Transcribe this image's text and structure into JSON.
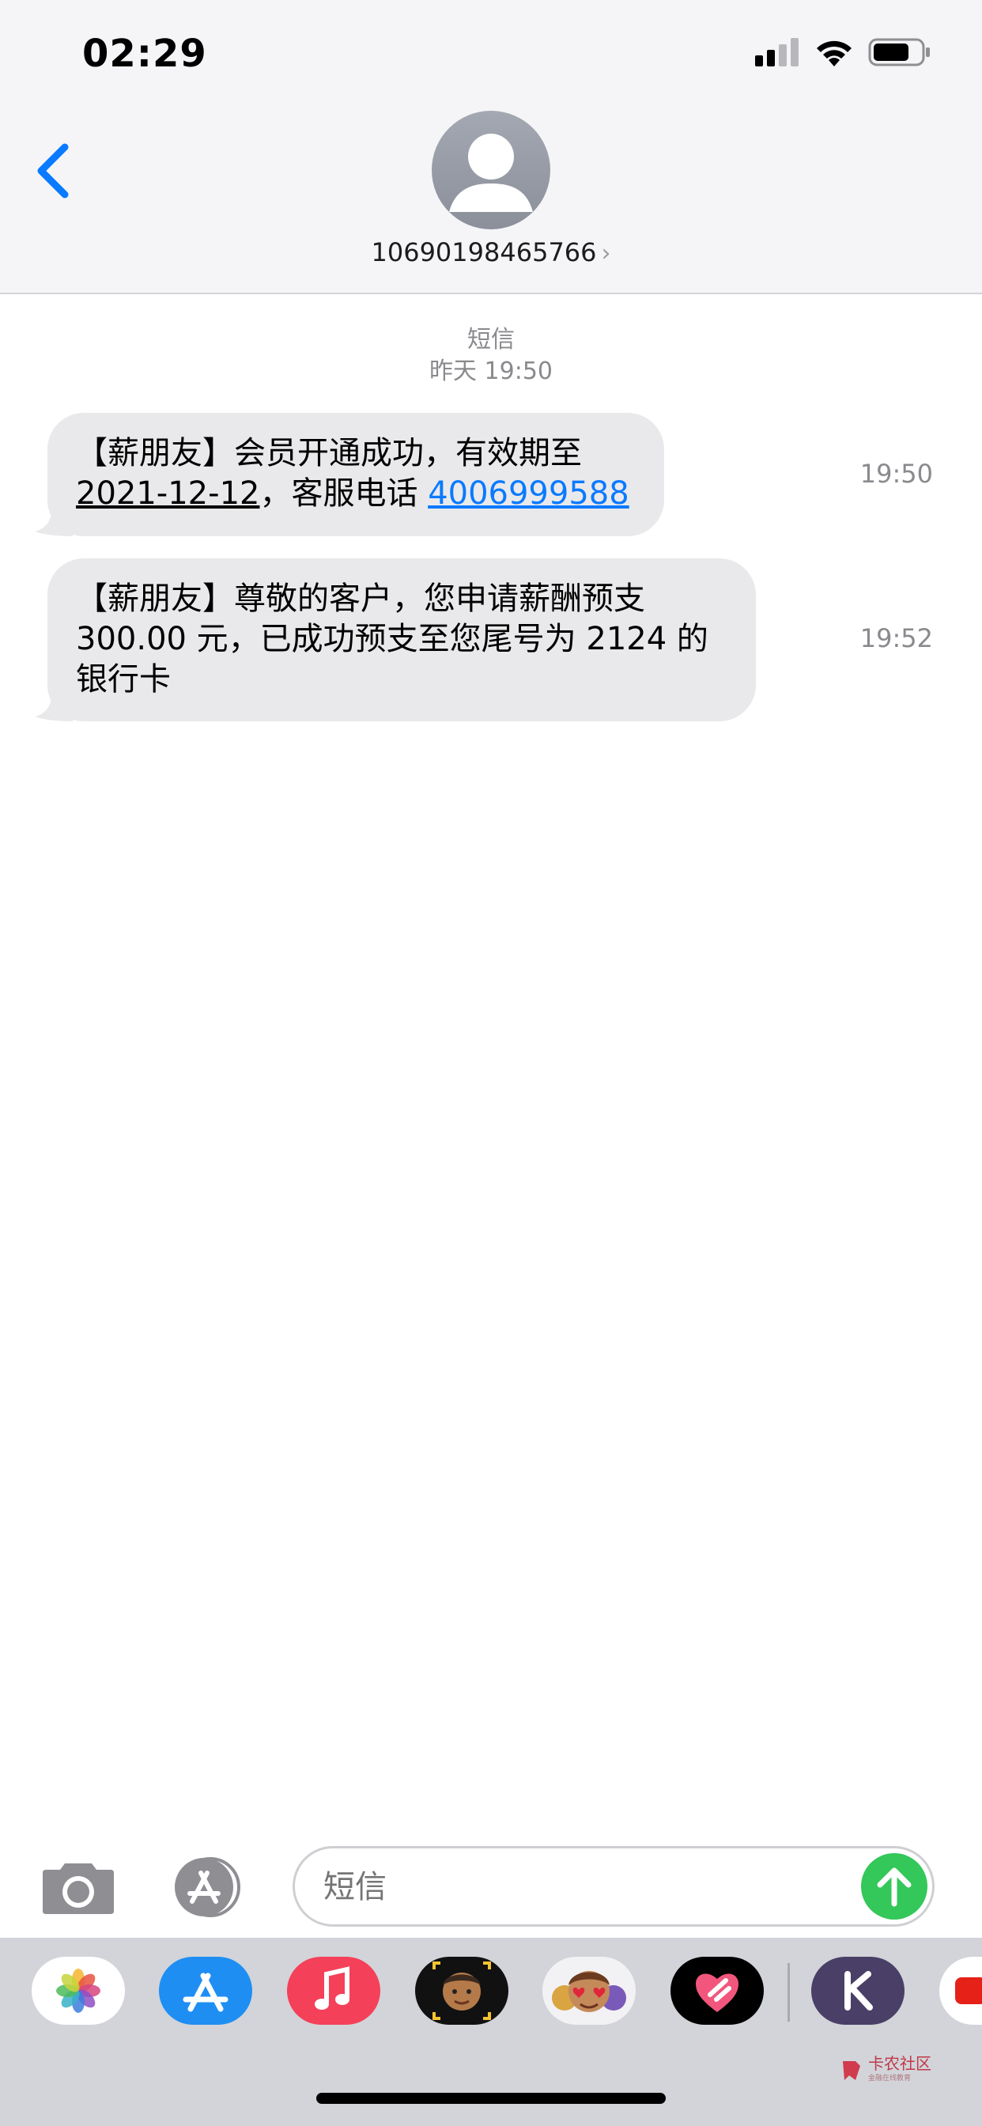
{
  "status_bar": {
    "time": "02:29"
  },
  "header": {
    "contact": "10690198465766",
    "chevron": "›"
  },
  "thread": {
    "service": "短信",
    "date": "昨天 19:50"
  },
  "messages": [
    {
      "text_before": "【薪朋友】会员开通成功，有效期至",
      "date": "2021-12-12",
      "text_mid": "，客服电话 ",
      "phone": "4006999588",
      "time": "19:50"
    },
    {
      "line1": "【薪朋友】尊敬的客户，您申请薪酬预支",
      "line2": "300.00 元，已成功预支至您尾号为 2124 的",
      "line3": "银行卡",
      "time": "19:52"
    }
  ],
  "composer": {
    "placeholder": "短信"
  },
  "apps": [
    "photos-icon",
    "app-store-icon",
    "music-icon",
    "memoji-icon",
    "animoji-icon",
    "digital-touch-icon",
    "keep-icon",
    "youtube-icon"
  ],
  "watermark": {
    "title": "卡农社区",
    "subtitle": "金融在线教育"
  }
}
